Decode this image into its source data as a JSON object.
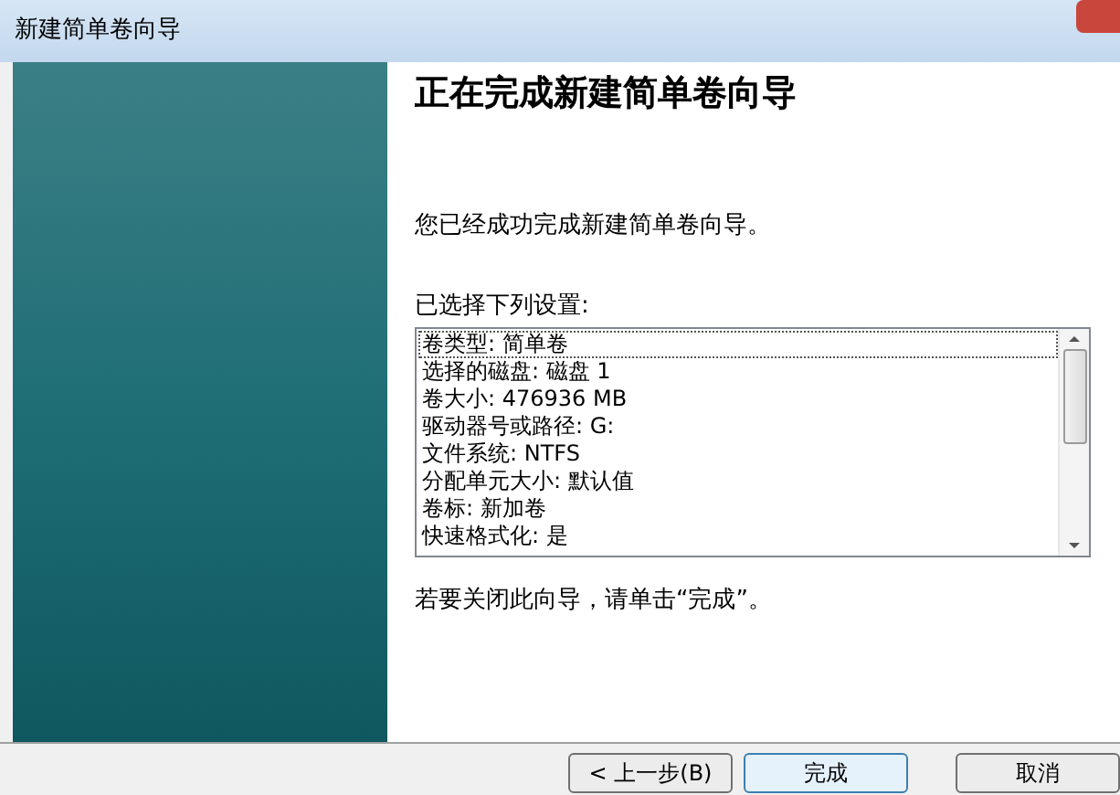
{
  "window": {
    "title": "新建简单卷向导"
  },
  "heading": "正在完成新建简单卷向导",
  "message": "您已经成功完成新建简单卷向导。",
  "settings_label": "已选择下列设置:",
  "settings": [
    {
      "text": "卷类型: 简单卷",
      "selected": true
    },
    {
      "text": "选择的磁盘: 磁盘 1",
      "selected": false
    },
    {
      "text": "卷大小: 476936 MB",
      "selected": false
    },
    {
      "text": "驱动器号或路径: G:",
      "selected": false
    },
    {
      "text": "文件系统: NTFS",
      "selected": false
    },
    {
      "text": "分配单元大小: 默认值",
      "selected": false
    },
    {
      "text": "卷标: 新加卷",
      "selected": false
    },
    {
      "text": "快速格式化: 是",
      "selected": false
    }
  ],
  "hint": "若要关闭此向导，请单击“完成”。",
  "buttons": [
    {
      "label": "< 上一步(B)",
      "kind": "normal"
    },
    {
      "label": "完成",
      "kind": "default"
    },
    {
      "label": "取消",
      "kind": "normal"
    }
  ]
}
